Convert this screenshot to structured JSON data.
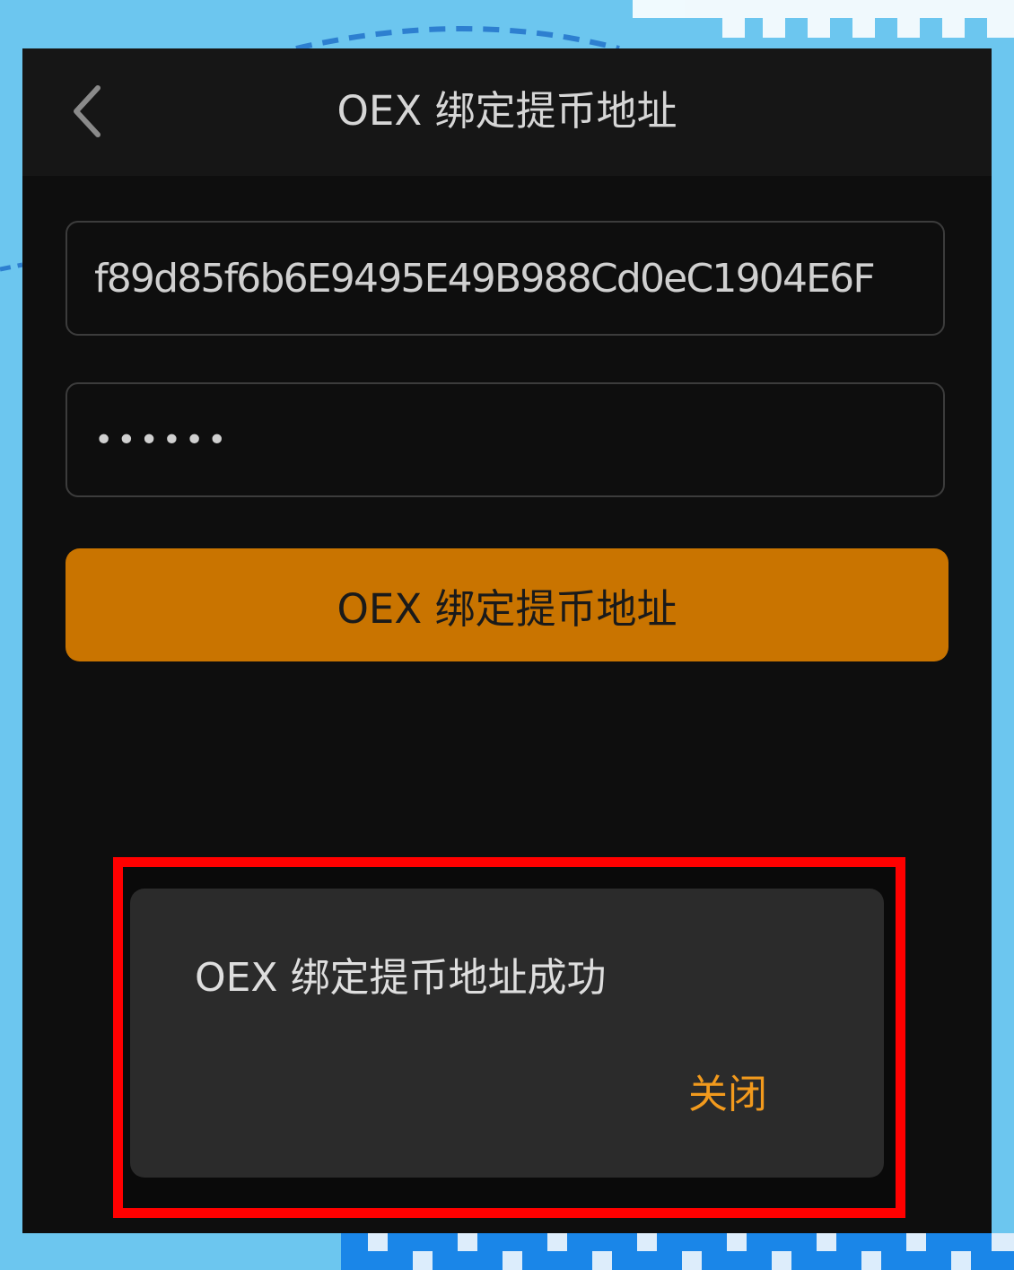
{
  "header": {
    "title": "OEX 绑定提币地址",
    "back_icon": "chevron-left-icon"
  },
  "form": {
    "address_value": "f89d85f6b6E9495E49B988Cd0eC1904E6F",
    "password_value": "••••••",
    "submit_label": "OEX 绑定提币地址"
  },
  "dialog": {
    "message": "OEX 绑定提币地址成功",
    "close_label": "关闭"
  },
  "colors": {
    "accent": "#c97400",
    "close_text": "#f29a1d",
    "highlight": "#ff0000",
    "background": "#0e0e0e"
  }
}
